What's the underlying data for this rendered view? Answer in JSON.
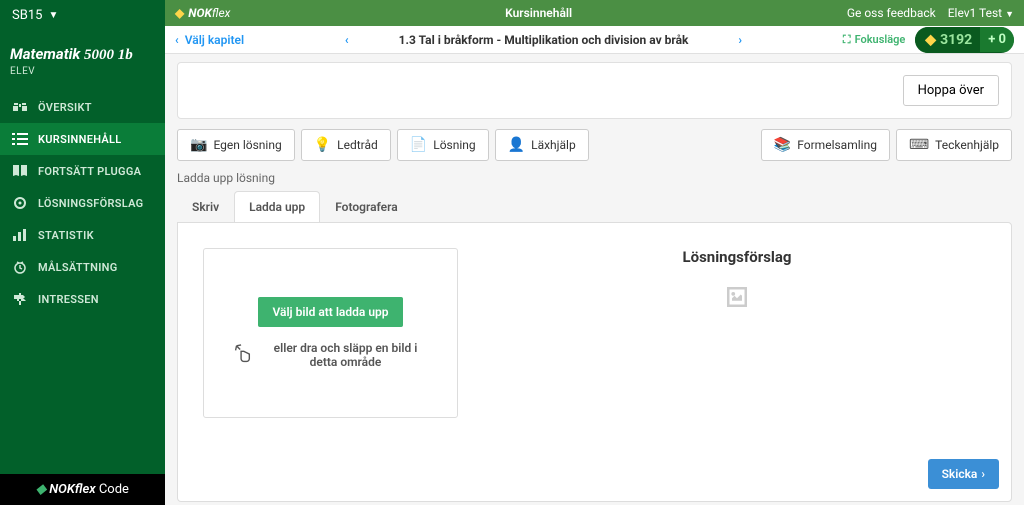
{
  "sidebar": {
    "dropdown": "SB15",
    "title_part1": "Matematik",
    "title_part2": "5000 1b",
    "elev": "ELEV",
    "items": [
      {
        "label": "ÖVERSIKT"
      },
      {
        "label": "KURSINNEHÅLL"
      },
      {
        "label": "FORTSÄTT PLUGGA"
      },
      {
        "label": "LÖSNINGSFÖRSLAG"
      },
      {
        "label": "STATISTIK"
      },
      {
        "label": "MÅLSÄTTNING"
      },
      {
        "label": "INTRESSEN"
      }
    ],
    "footer_brand": "NOK",
    "footer_flex": "flex",
    "footer_code": "Code"
  },
  "topbar": {
    "brand_nok": "NOK",
    "brand_flex": "flex",
    "title": "Kursinnehåll",
    "feedback": "Ge oss feedback",
    "user": "Elev1 Test"
  },
  "chapterbar": {
    "choose_chapter": "Välj kapitel",
    "current": "1.3 Tal i bråkform - Multiplikation och division av bråk",
    "focus_mode": "Fokusläge",
    "score": "3192",
    "plus": "+ 0"
  },
  "panel": {
    "skip": "Hoppa över"
  },
  "toolbar": {
    "own": "Egen lösning",
    "hint": "Ledtråd",
    "solution": "Lösning",
    "homework": "Läxhjälp",
    "formulas": "Formelsamling",
    "sign_help": "Teckenhjälp"
  },
  "sub_label": "Ladda upp lösning",
  "tabs": {
    "write": "Skriv",
    "upload": "Ladda upp",
    "photo": "Fotografera"
  },
  "upload": {
    "button": "Välj bild att ladda upp",
    "drag_text": "eller dra och släpp en bild i detta område"
  },
  "preview": {
    "title": "Lösningsförslag"
  },
  "send": "Skicka"
}
